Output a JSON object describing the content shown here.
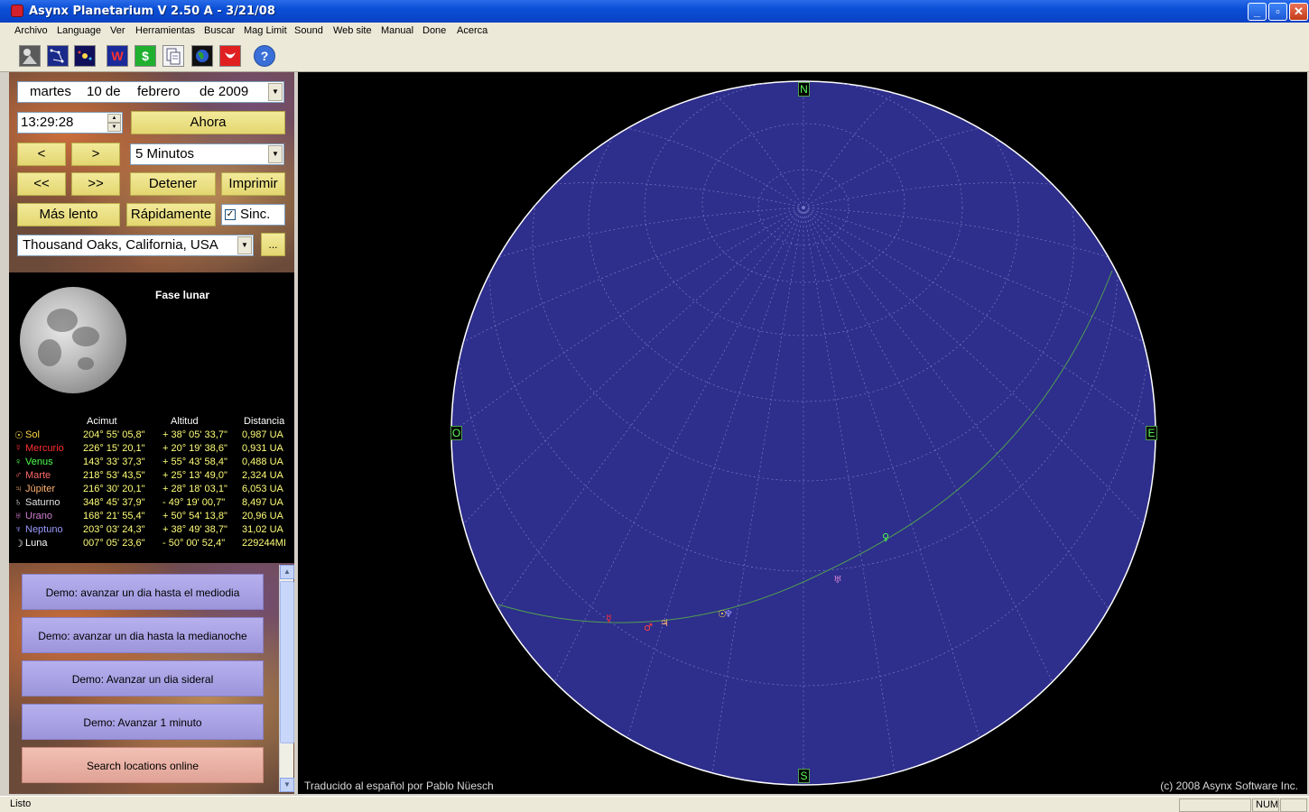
{
  "window": {
    "title": "Asynx Planetarium V 2.50 A - 3/21/08",
    "min": "_",
    "max": "▫",
    "close": "✕"
  },
  "menu": [
    "Archivo",
    "Language",
    "Ver",
    "Herramientas",
    "Buscar",
    "Mag Limit",
    "Sound",
    "Web site",
    "Manual",
    "Done",
    "Acerca"
  ],
  "toolbar": {
    "w_label": "W",
    "dollar_label": "$",
    "help_label": "?"
  },
  "controls": {
    "day": "martes",
    "daynum": "10 de",
    "month": "febrero",
    "year": "de 2009",
    "time": "13:29:28",
    "now": "Ahora",
    "prev": "<",
    "next": ">",
    "step": "5 Minutos",
    "fast_back": "<<",
    "fast_fwd": ">>",
    "stop": "Detener",
    "print": "Imprimir",
    "slower": "Más lento",
    "faster": "Rápidamente",
    "sync_label": "Sinc.",
    "sync_checked": true,
    "location": "Thousand Oaks, California, USA",
    "more": "..."
  },
  "moon_phase": {
    "title": "Fase lunar"
  },
  "ephemeris": {
    "headers": [
      "Acimut",
      "Altitud",
      "Distancia"
    ],
    "rows": [
      {
        "sym": "☉",
        "name": "Sol",
        "color": "#ffd84a",
        "az": "204° 55' 05,8\"",
        "alt": "+ 38° 05' 33,7\"",
        "dist": "0,987 UA"
      },
      {
        "sym": "☿",
        "name": "Mercurio",
        "color": "#ff3030",
        "az": "226° 15' 20,1\"",
        "alt": "+ 20° 19' 38,6\"",
        "dist": "0,931 UA"
      },
      {
        "sym": "♀",
        "name": "Venus",
        "color": "#4cff4c",
        "az": "143° 33' 37,3\"",
        "alt": "+ 55° 43' 58,4\"",
        "dist": "0,488 UA"
      },
      {
        "sym": "♂",
        "name": "Marte",
        "color": "#ff6a6a",
        "az": "218° 53' 43,5\"",
        "alt": "+ 25° 13' 49,0\"",
        "dist": "2,324 UA"
      },
      {
        "sym": "♃",
        "name": "Júpiter",
        "color": "#ffb070",
        "az": "216° 30' 20,1\"",
        "alt": "+ 28° 18' 03,1\"",
        "dist": "6,053 UA"
      },
      {
        "sym": "♄",
        "name": "Saturno",
        "color": "#e0e0e0",
        "az": "348° 45' 37,9\"",
        "alt": "-  49° 19' 00,7\"",
        "dist": "8,497 UA"
      },
      {
        "sym": "♅",
        "name": "Urano",
        "color": "#d080d0",
        "az": "168° 21' 55,4\"",
        "alt": "+ 50° 54' 13,8\"",
        "dist": "20,96 UA"
      },
      {
        "sym": "♆",
        "name": "Neptuno",
        "color": "#9a9aff",
        "az": "203° 03' 24,3\"",
        "alt": "+ 38° 49' 38,7\"",
        "dist": "31,02 UA"
      },
      {
        "sym": "☽",
        "name": "Luna",
        "color": "#ffffff",
        "az": "007° 05' 23,6\"",
        "alt": "-  50° 00' 52,4\"",
        "dist": "229244MI"
      }
    ]
  },
  "demos": [
    "Demo: avanzar un dia hasta el mediodia",
    "Demo: avanzar un dia hasta la medianoche",
    "Demo: Avanzar un dia sideral",
    "Demo: Avanzar 1 minuto",
    "Search locations online"
  ],
  "sky": {
    "north": "N",
    "south": "S",
    "east": "E",
    "west": "O",
    "credit_left": "Traducido al español por Pablo Nüesch",
    "credit_right": "(c) 2008 Asynx Software Inc.",
    "colors": {
      "sky": "#2e2e8c",
      "ecliptic": "#50a050",
      "grid": "#7070c0",
      "bg": "#000000"
    },
    "planet_marks": [
      {
        "sym": "♀",
        "color": "#4cff4c"
      },
      {
        "sym": "♅",
        "color": "#d080d0"
      },
      {
        "sym": "☉",
        "color": "#ffd84a"
      },
      {
        "sym": "♆",
        "color": "#9a9aff"
      },
      {
        "sym": "☿",
        "color": "#ff3030"
      },
      {
        "sym": "♂",
        "color": "#ff4040"
      },
      {
        "sym": "♃",
        "color": "#ffb070"
      }
    ]
  },
  "status": {
    "text": "Listo",
    "num": "NUM"
  }
}
